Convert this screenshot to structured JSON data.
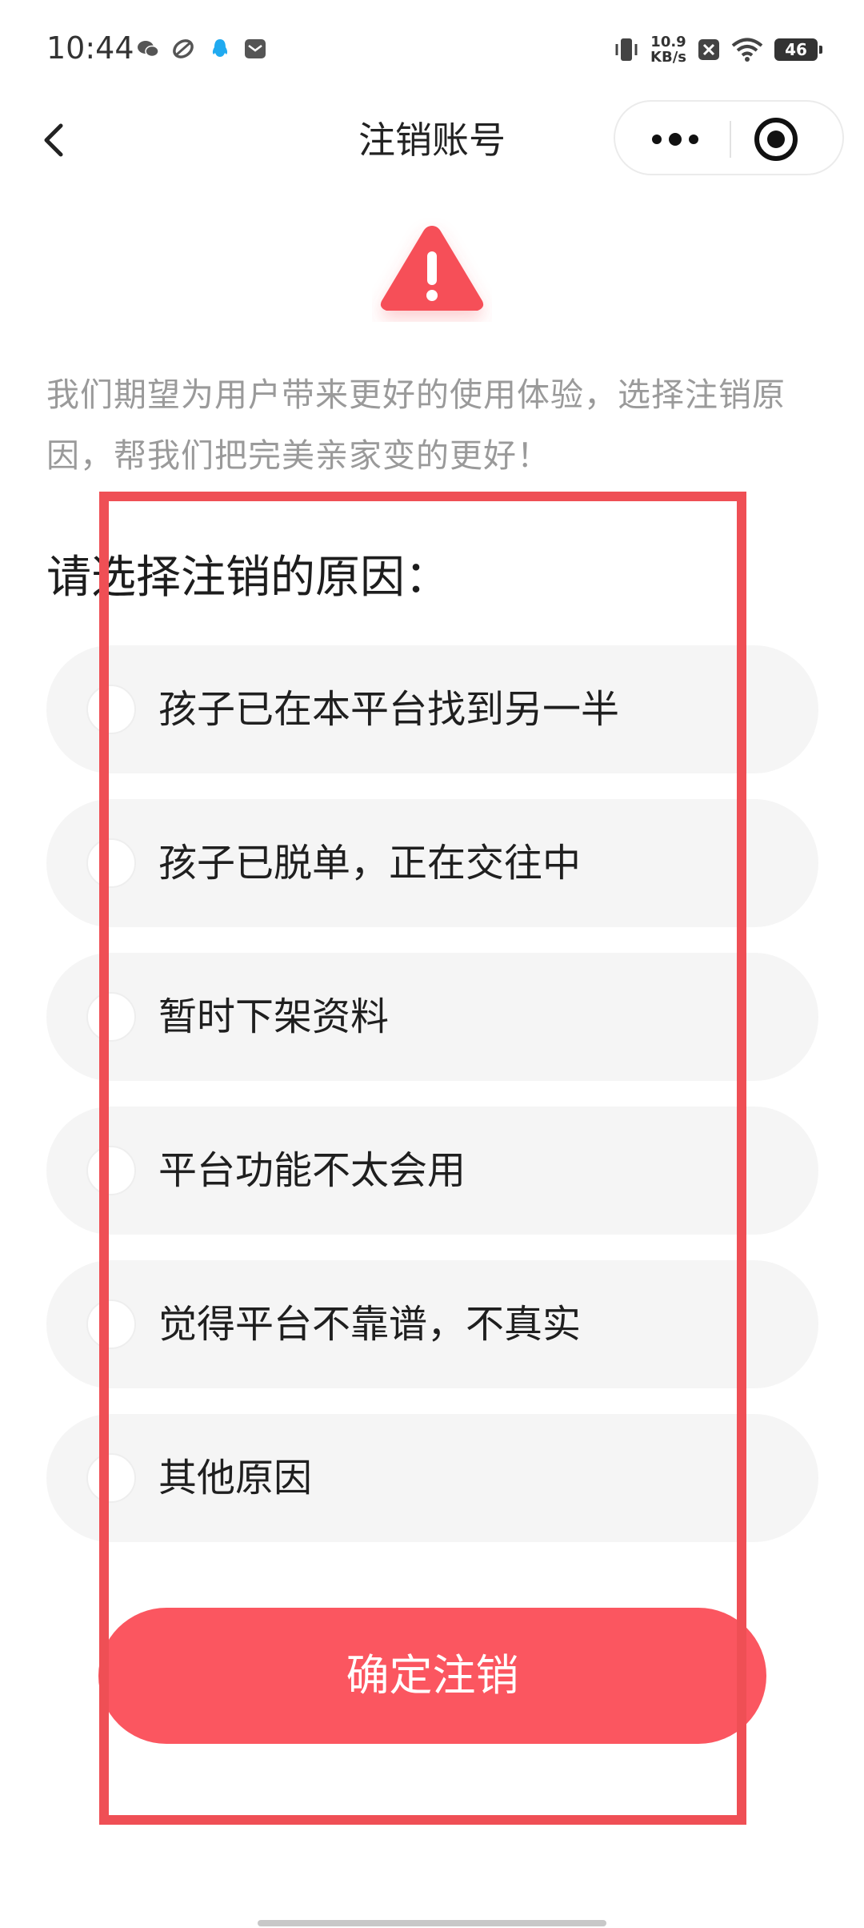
{
  "status_bar": {
    "time": "10:44",
    "net_speed_value": "10.9",
    "net_speed_unit": "KB/s",
    "battery": "46",
    "icons": [
      "wechat-icon",
      "link-icon",
      "qq-icon",
      "mail-icon",
      "vibrate-icon",
      "network-speed",
      "x-badge-icon",
      "wifi-icon",
      "battery-icon"
    ]
  },
  "nav": {
    "title": "注销账号",
    "back_icon": "chevron-left-icon",
    "more_icon": "more-dots-icon",
    "close_icon": "target-close-icon"
  },
  "intro_text": "我们期望为用户带来更好的使用体验，选择注销原因，帮我们把完美亲家变的更好！",
  "section_title": "请选择注销的原因：",
  "options": [
    {
      "label": "孩子已在本平台找到另一半"
    },
    {
      "label": "孩子已脱单，正在交往中"
    },
    {
      "label": "暂时下架资料"
    },
    {
      "label": "平台功能不太会用"
    },
    {
      "label": "觉得平台不靠谱，不真实"
    },
    {
      "label": "其他原因"
    }
  ],
  "confirm_button": "确定注销",
  "colors": {
    "accent": "#fb5660",
    "warning": "#f64f59",
    "annotation": "#ef4f55",
    "option_bg": "#f5f5f5"
  }
}
